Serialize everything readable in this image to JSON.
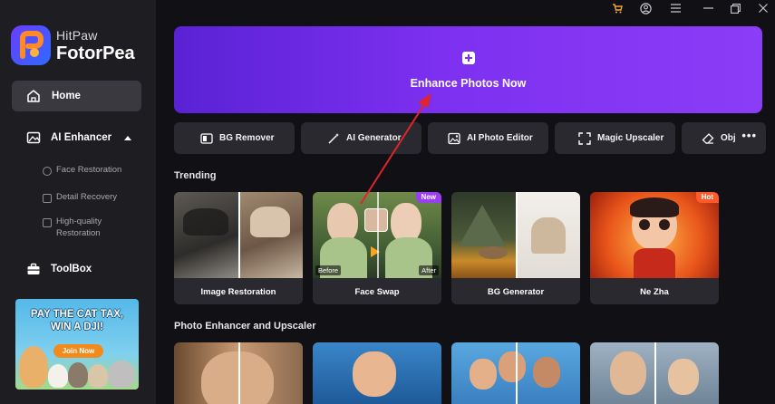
{
  "app": {
    "brand_line1": "HitPaw",
    "brand_line2": "FotorPea"
  },
  "sidebar": {
    "home": "Home",
    "ai_enhancer": "AI Enhancer",
    "sub_items": [
      "Face Restoration",
      "Detail Recovery",
      "High-quality Restoration"
    ],
    "toolbox": "ToolBox"
  },
  "ad": {
    "title_line1": "PAY THE CAT TAX,",
    "title_line2": "WIN A DJI!",
    "button": "Join Now"
  },
  "hero": {
    "label": "Enhance Photos Now"
  },
  "tools": [
    "BG Remover",
    "AI Generator",
    "AI Photo Editor",
    "Magic Upscaler",
    "Obj"
  ],
  "trending": {
    "title": "Trending",
    "cards": [
      {
        "label": "Image Restoration",
        "badge": ""
      },
      {
        "label": "Face Swap",
        "badge": "New",
        "before": "Before",
        "after": "After"
      },
      {
        "label": "BG Generator",
        "badge": ""
      },
      {
        "label": "Ne Zha",
        "badge": "Hot"
      }
    ]
  },
  "upscaler": {
    "title": "Photo Enhancer and Upscaler"
  },
  "colors": {
    "accent": "#7d30f0",
    "new_badge": "#9b3df5",
    "hot_badge": "#ff5a2a",
    "arrow": "#e0242c"
  }
}
